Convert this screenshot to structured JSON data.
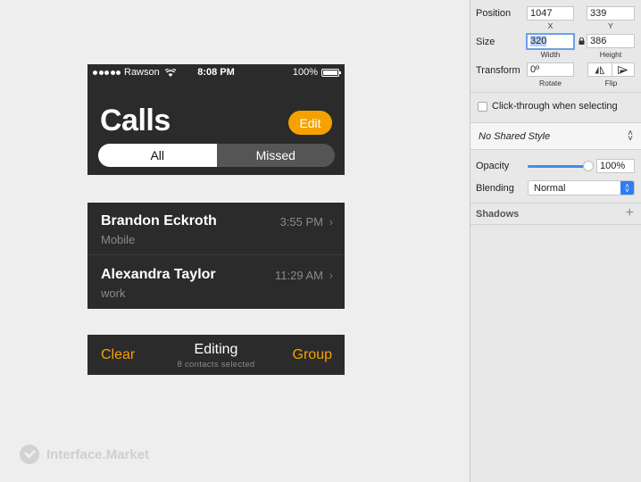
{
  "phone": {
    "status": {
      "carrier": "Rawson",
      "time": "8:08 PM",
      "battery": "100%"
    },
    "title": "Calls",
    "edit_label": "Edit",
    "segments": [
      {
        "label": "All",
        "active": true
      },
      {
        "label": "Missed",
        "active": false
      }
    ]
  },
  "contacts": [
    {
      "name": "Brandon Eckroth",
      "sub": "Mobile",
      "time": "3:55 PM"
    },
    {
      "name": "Alexandra Taylor",
      "sub": "work",
      "time": "11:29 AM"
    }
  ],
  "toolbar": {
    "clear_label": "Clear",
    "title": "Editing",
    "subtitle": "8 contacts selected",
    "group_label": "Group"
  },
  "watermark": {
    "text": "Interface.Market"
  },
  "inspector": {
    "position": {
      "label": "Position",
      "x": "1047",
      "y": "339",
      "x_caption": "X",
      "y_caption": "Y"
    },
    "size": {
      "label": "Size",
      "width": "320",
      "height": "386",
      "width_caption": "Width",
      "height_caption": "Height"
    },
    "transform": {
      "label": "Transform",
      "rotate": "0º",
      "rotate_caption": "Rotate",
      "flip_caption": "Flip"
    },
    "click_through_label": "Click-through when selecting",
    "shared_style": "No Shared Style",
    "opacity": {
      "label": "Opacity",
      "value": "100%",
      "level": 1.0
    },
    "blending": {
      "label": "Blending",
      "value": "Normal"
    },
    "shadows_label": "Shadows"
  },
  "colors": {
    "accent_orange": "#f5a100",
    "dark_panel": "#2b2b2b",
    "focus_blue": "#6ea0e8",
    "slider_blue": "#3d8ef0"
  }
}
